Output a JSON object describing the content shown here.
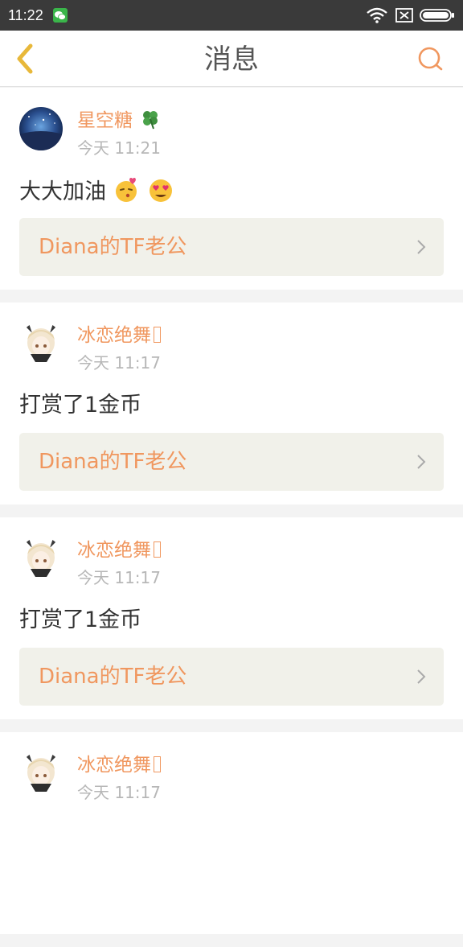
{
  "status_bar": {
    "time": "11:22",
    "icons": [
      "wechat-icon",
      "wifi-icon",
      "sim-icon",
      "battery-icon"
    ]
  },
  "nav": {
    "title": "消息",
    "left_icon": "back-icon",
    "right_icon": "search-icon",
    "accent_color": "#f0975f"
  },
  "messages": [
    {
      "user": "星空糖",
      "user_suffix_icon": "clover-icon",
      "time": "今天 11:21",
      "text": "大大加油",
      "emojis": [
        "kiss-emoji-icon",
        "heart-eyes-emoji-icon"
      ],
      "link": "Diana的TF老公",
      "avatar": "starry-sky-avatar"
    },
    {
      "user": "冰恋绝舞",
      "time": "今天 11:17",
      "text": "打赏了1金币",
      "link": "Diana的TF老公",
      "avatar": "anime-girl-avatar"
    },
    {
      "user": "冰恋绝舞",
      "time": "今天 11:17",
      "text": "打赏了1金币",
      "link": "Diana的TF老公",
      "avatar": "anime-girl-avatar"
    },
    {
      "user": "冰恋绝舞",
      "time": "今天 11:17",
      "text": "",
      "link": "",
      "avatar": "anime-girl-avatar"
    }
  ]
}
